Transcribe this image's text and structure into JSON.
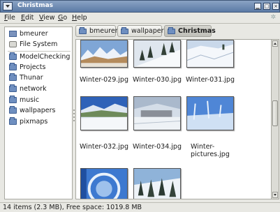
{
  "window": {
    "title": "Christmas",
    "titlebar_bg": "#5b7aa6"
  },
  "menubar": {
    "items": [
      {
        "label": "File",
        "mnemonic": "F"
      },
      {
        "label": "Edit",
        "mnemonic": "E"
      },
      {
        "label": "View",
        "mnemonic": "V"
      },
      {
        "label": "Go",
        "mnemonic": "G"
      },
      {
        "label": "Help",
        "mnemonic": "H"
      }
    ]
  },
  "sidebar": {
    "items": [
      {
        "label": "bmeurer",
        "icon": "home-folder-icon"
      },
      {
        "label": "File System",
        "icon": "drive-icon"
      },
      {
        "label": "ModelChecking",
        "icon": "folder-icon"
      },
      {
        "label": "Projects",
        "icon": "folder-icon"
      },
      {
        "label": "Thunar",
        "icon": "folder-icon"
      },
      {
        "label": "network",
        "icon": "folder-icon"
      },
      {
        "label": "music",
        "icon": "folder-icon"
      },
      {
        "label": "wallpapers",
        "icon": "folder-icon"
      },
      {
        "label": "pixmaps",
        "icon": "folder-icon"
      }
    ]
  },
  "pathbar": {
    "crumbs": [
      {
        "label": "bmeurer",
        "active": false
      },
      {
        "label": "wallpapers",
        "active": false
      },
      {
        "label": "Christmas",
        "active": true
      }
    ]
  },
  "files": [
    {
      "name": "Winter-029.jpg",
      "scene": "peaks-blue"
    },
    {
      "name": "Winter-030.jpg",
      "scene": "trees-slope"
    },
    {
      "name": "Winter-031.jpg",
      "scene": "snowfield"
    },
    {
      "name": "Winter-032.jpg",
      "scene": "lake-valley"
    },
    {
      "name": "Winter-034.jpg",
      "scene": "village"
    },
    {
      "name_line1": "Winter-",
      "name_line2": "pictures.jpg",
      "scene": "frosted-trees"
    },
    {
      "name": "",
      "scene": "ice-blue"
    },
    {
      "name": "",
      "scene": "forest-snow"
    }
  ],
  "statusbar": {
    "text": "14 items (2.3 MB), Free space: 1019.8 MB"
  },
  "scrollbar": {
    "position_fraction": 0.45,
    "visible_fraction": 0.18
  }
}
